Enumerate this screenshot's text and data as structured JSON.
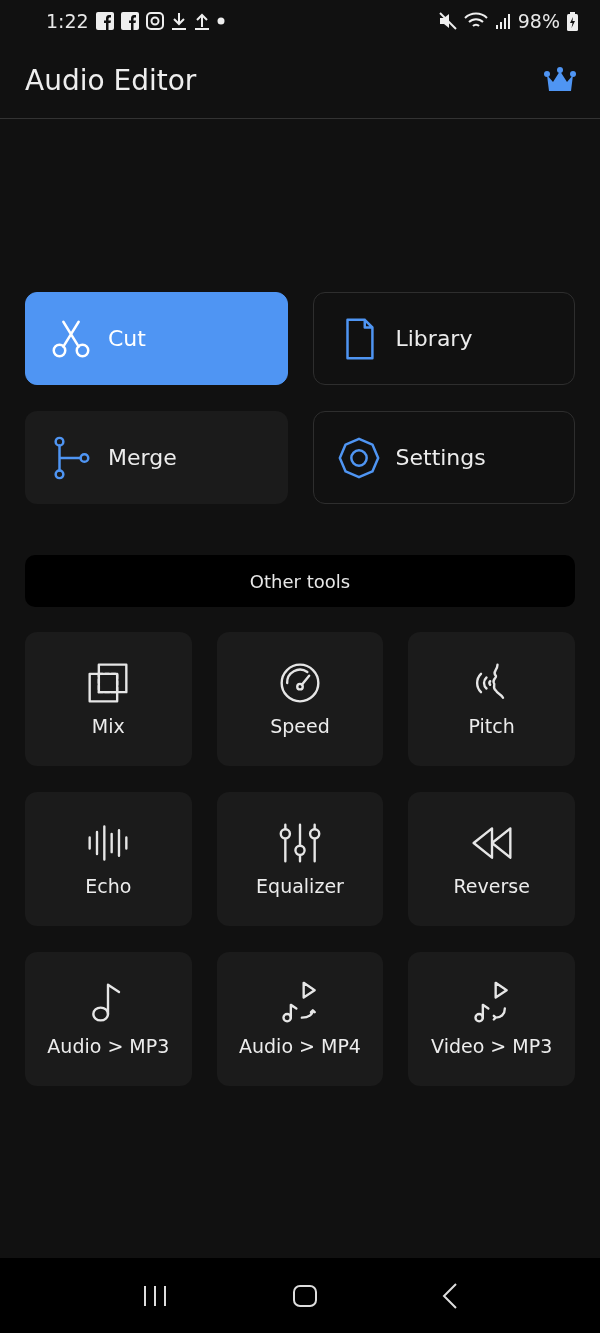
{
  "status_bar": {
    "time": "1:22",
    "battery": "98%"
  },
  "header": {
    "title": "Audio Editor"
  },
  "main_actions": [
    {
      "label": "Cut",
      "selected": true,
      "kind": "filled"
    },
    {
      "label": "Library",
      "selected": false,
      "kind": "outlined"
    },
    {
      "label": "Merge",
      "selected": false,
      "kind": "filled"
    },
    {
      "label": "Settings",
      "selected": false,
      "kind": "outlined"
    }
  ],
  "section": {
    "title": "Other tools"
  },
  "tools": [
    {
      "label": "Mix"
    },
    {
      "label": "Speed"
    },
    {
      "label": "Pitch"
    },
    {
      "label": "Echo"
    },
    {
      "label": "Equalizer"
    },
    {
      "label": "Reverse"
    },
    {
      "label": "Audio > MP3"
    },
    {
      "label": "Audio > MP4"
    },
    {
      "label": "Video > MP3"
    }
  ]
}
